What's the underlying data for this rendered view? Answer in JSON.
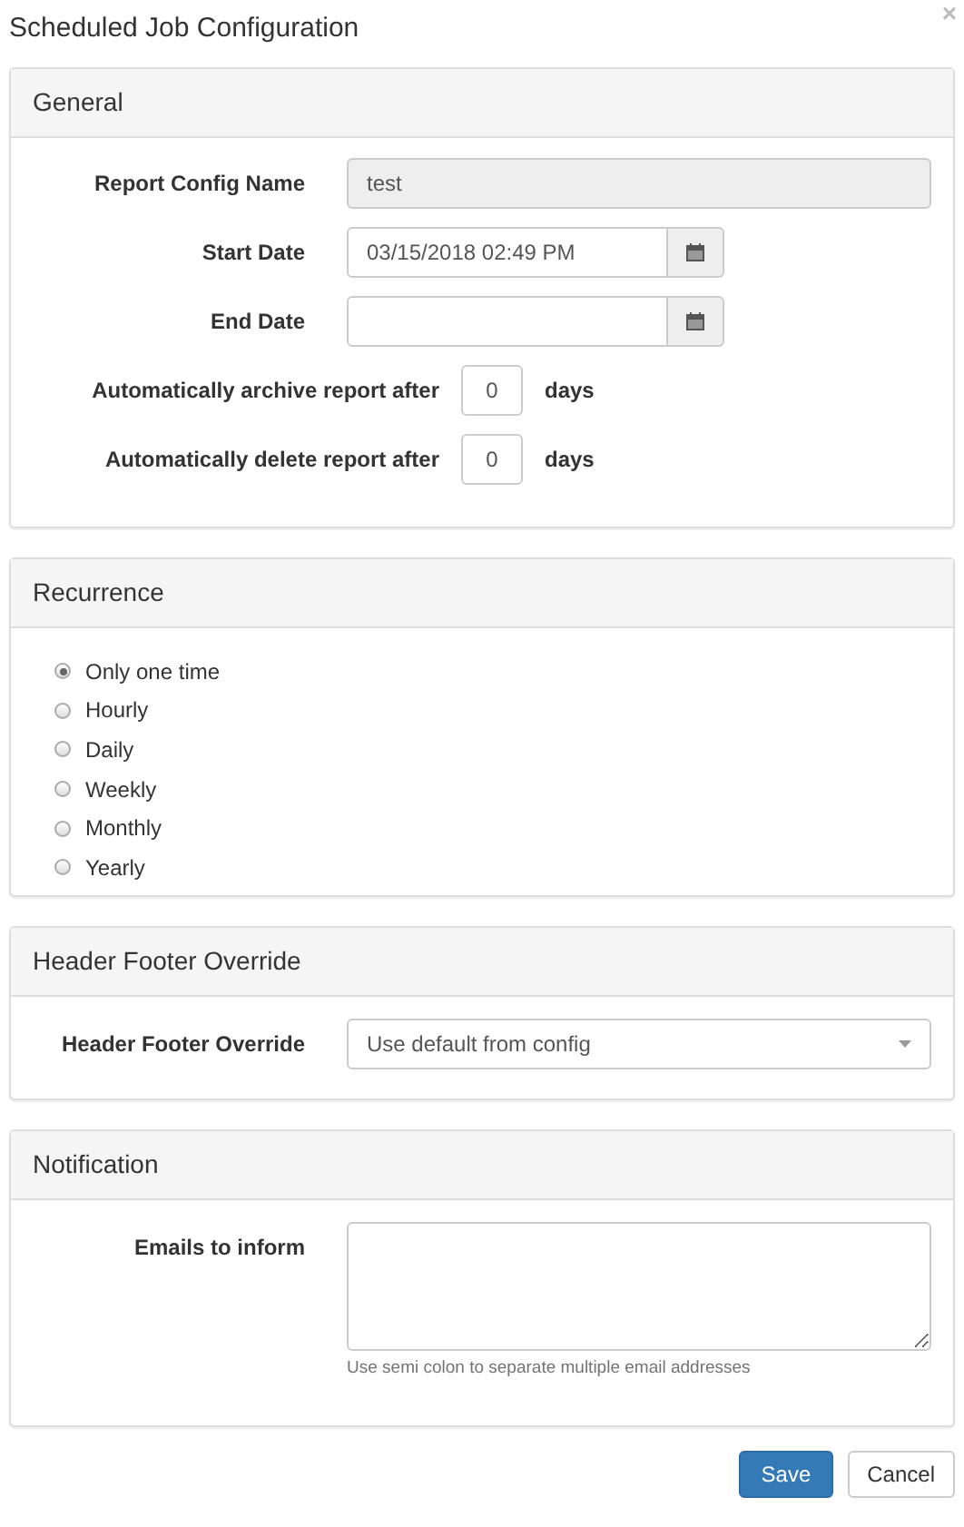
{
  "dialog": {
    "title": "Scheduled Job Configuration",
    "close": "×"
  },
  "general": {
    "heading": "General",
    "fields": [
      {
        "kind": "text",
        "label": "Report Config Name",
        "value": "test",
        "readonly": true
      },
      {
        "kind": "date",
        "label": "Start Date",
        "value": "03/15/2018 02:49 PM",
        "readonly": false
      },
      {
        "kind": "date",
        "label": "End Date",
        "readonly": false
      },
      {
        "kind": "days",
        "label": "Automatically archive report after",
        "value": "0",
        "unit": "days",
        "readonly": false
      },
      {
        "kind": "days",
        "label": "Automatically delete report after",
        "value": "0",
        "unit": "days",
        "readonly": false
      }
    ]
  },
  "recurrence": {
    "heading": "Recurrence",
    "options": [
      {
        "label": "Only one time",
        "selected": true
      },
      {
        "label": "Hourly",
        "selected": false
      },
      {
        "label": "Daily",
        "selected": false
      },
      {
        "label": "Weekly",
        "selected": false
      },
      {
        "label": "Monthly",
        "selected": false
      },
      {
        "label": "Yearly",
        "selected": false
      }
    ]
  },
  "header_footer": {
    "heading": "Header Footer Override",
    "label": "Header Footer Override",
    "value": "Use default from config"
  },
  "notification": {
    "heading": "Notification",
    "label": "Emails to inform",
    "help": "Use semi colon to separate multiple email addresses"
  },
  "buttons": [
    {
      "label": "Save",
      "kind": "primary"
    },
    {
      "label": "Cancel",
      "kind": "default"
    }
  ]
}
